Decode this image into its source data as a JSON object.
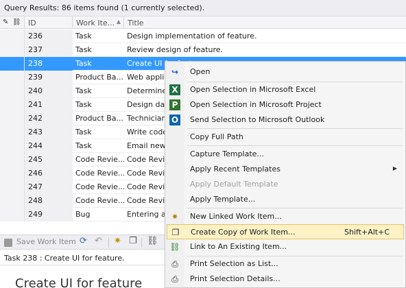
{
  "header": {
    "summary": "Query Results: 86 items found (1 currently selected)."
  },
  "grid": {
    "columns": {
      "id": "ID",
      "type": "Work Ite...",
      "title": "Title"
    },
    "icons": {
      "edit": "pencil-icon",
      "links": "link-icon"
    },
    "rows": [
      {
        "id": "236",
        "type": "Task",
        "title": "Design implementation of feature."
      },
      {
        "id": "237",
        "type": "Task",
        "title": "Review design of feature."
      },
      {
        "id": "238",
        "type": "Task",
        "title": "Create UI for feature."
      },
      {
        "id": "239",
        "type": "Product Ba...",
        "title": "Web applic"
      },
      {
        "id": "240",
        "type": "Task",
        "title": "Determine"
      },
      {
        "id": "241",
        "type": "Task",
        "title": "Design dat"
      },
      {
        "id": "242",
        "type": "Product Ba...",
        "title": "Technician"
      },
      {
        "id": "243",
        "type": "Task",
        "title": "Write code"
      },
      {
        "id": "244",
        "type": "Task",
        "title": "Email new"
      },
      {
        "id": "245",
        "type": "Code Revie...",
        "title": "Code Revie"
      },
      {
        "id": "246",
        "type": "Code Revie...",
        "title": "Code Revie"
      },
      {
        "id": "247",
        "type": "Code Revie...",
        "title": "Code Revie"
      },
      {
        "id": "248",
        "type": "Code Revie...",
        "title": "Code Revie"
      },
      {
        "id": "249",
        "type": "Bug",
        "title": "Entering a"
      }
    ],
    "selected_id": "238"
  },
  "toolbar": {
    "save_label": "Save Work Item"
  },
  "detail": {
    "task_line": "Task 238 : Create UI for feature.",
    "big_title": "Create UI for feature"
  },
  "context_menu": {
    "items": [
      {
        "label": "Open",
        "icon": "open-arrow-icon"
      },
      {
        "label": "Open Selection in Microsoft Excel",
        "icon": "excel-icon"
      },
      {
        "label": "Open Selection in Microsoft Project",
        "icon": "project-icon"
      },
      {
        "label": "Send Selection to Microsoft Outlook",
        "icon": "outlook-icon"
      },
      {
        "label": "Copy Full Path"
      },
      {
        "label": "Capture Template..."
      },
      {
        "label": "Apply Recent Templates"
      },
      {
        "label": "Apply Default Template",
        "disabled": true
      },
      {
        "label": "Apply Template..."
      },
      {
        "label": "New Linked Work Item...",
        "icon": "new-linked-item-icon"
      },
      {
        "label": "Create Copy of Work Item...",
        "icon": "copy-icon",
        "shortcut": "Shift+Alt+C",
        "highlighted": true
      },
      {
        "label": "Link to An Existing Item...",
        "icon": "link-existing-icon"
      },
      {
        "label": "Print Selection as List...",
        "icon": "printer-icon"
      },
      {
        "label": "Print Selection Details...",
        "icon": "printer-icon"
      }
    ]
  }
}
